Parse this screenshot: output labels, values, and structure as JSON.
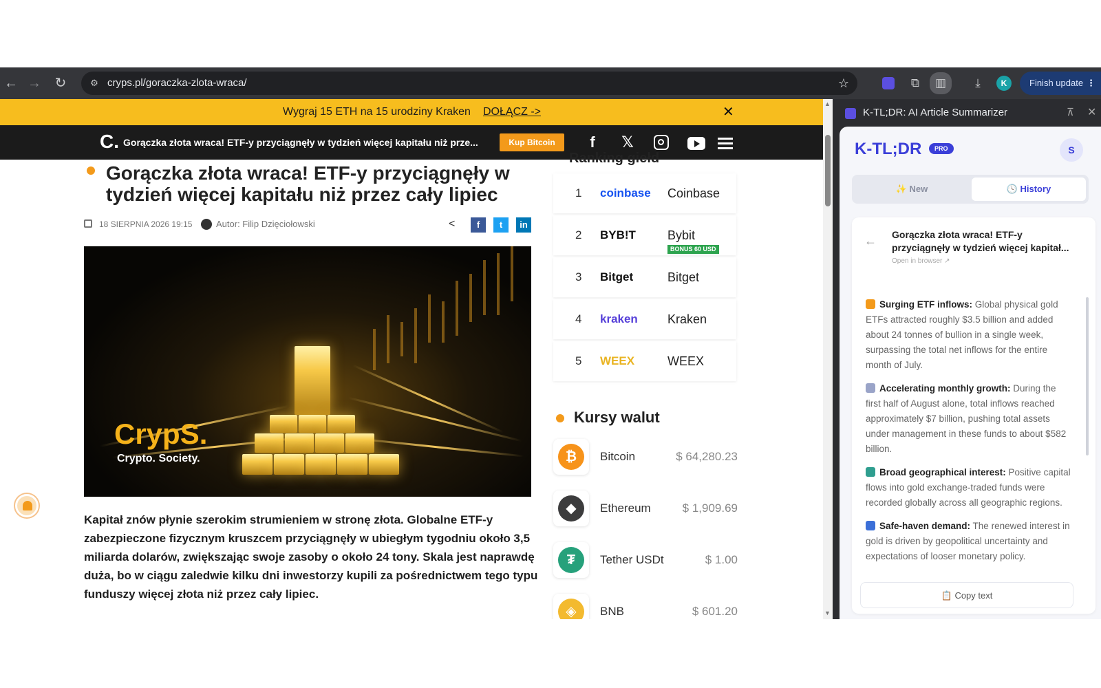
{
  "browser": {
    "url": "cryps.pl/goraczka-zlota-wraca/",
    "profile_initial": "K",
    "finish_update_label": "Finish update",
    "icons": [
      "back-icon",
      "forward-icon",
      "reload-icon",
      "site-info-icon",
      "star-icon",
      "ktldr-extension-icon",
      "extensions-puzzle-icon",
      "side-panel-icon",
      "download-icon",
      "more-vert-icon"
    ]
  },
  "site": {
    "promo": {
      "text": "Wygraj 15 ETH na 15 urodziny Kraken",
      "link": "DOŁĄCZ ->",
      "close": "✕"
    },
    "bar": {
      "logo": "C.",
      "title": "Gorączka złota wraca! ETF-y przyciągnęły w tydzień więcej kapitału niż prze...",
      "buy_label": "Kup Bitcoin"
    },
    "article": {
      "title": "Gorączka złota wraca! ETF-y przyciągnęły w tydzień więcej kapitału niż przez cały lipiec",
      "date": "18 SIERPNIA 2026 19:15",
      "author": "Autor: Filip Dzięciołowski",
      "hero_brand": "CrypS.",
      "hero_sub": "Crypto. Society.",
      "lead": "Kapitał znów płynie szerokim strumieniem w stronę złota. Globalne ETF-y zabezpieczone fizycznym kruszcem przyciągnęły w ubiegłym tygodniu około 3,5 miliarda dolarów, zwiększając swoje zasoby o około 24 tony. Skala jest naprawdę duża, bo w ciągu zaledwie kilku dni inwestorzy kupili za pośrednictwem tego typu funduszy więcej złota niż przez cały lipiec."
    },
    "ranking": {
      "heading": "Ranking giełd",
      "items": [
        {
          "num": "1",
          "logo": "coinbase",
          "name": "Coinbase",
          "color": "#1652f0"
        },
        {
          "num": "2",
          "logo": "BYB!T",
          "name": "Bybit",
          "color": "#111111",
          "bonus": "BONUS 60 USD"
        },
        {
          "num": "3",
          "logo": "Bitget",
          "name": "Bitget",
          "color": "#111111"
        },
        {
          "num": "4",
          "logo": "kraken",
          "name": "Kraken",
          "color": "#5741d9"
        },
        {
          "num": "5",
          "logo": "WEEX",
          "name": "WEEX",
          "color": "#e9b423"
        }
      ]
    },
    "rates": {
      "heading": "Kursy walut",
      "items": [
        {
          "name": "Bitcoin",
          "price": "$ 64,280.23",
          "symbol": "₿",
          "color": "#f7931a"
        },
        {
          "name": "Ethereum",
          "price": "$ 1,909.69",
          "symbol": "◆",
          "color": "#3c3c3d"
        },
        {
          "name": "Tether USDt",
          "price": "$ 1.00",
          "symbol": "₮",
          "color": "#26a17b"
        },
        {
          "name": "BNB",
          "price": "$ 601.20",
          "symbol": "◈",
          "color": "#f3ba2f"
        }
      ]
    }
  },
  "panel": {
    "title": "K-TL;DR: AI Article Summarizer",
    "brand": "K-TL;DR",
    "pro": "PRO",
    "user_initial": "S",
    "tabs": {
      "new": "✨ New",
      "history": "🕓 History"
    },
    "card": {
      "title": "Gorączka złota wraca! ETF-y przyciągnęły w tydzień więcej kapitał...",
      "open_link": "Open in browser ↗",
      "points": [
        {
          "icon_color": "#f39a1b",
          "heading": "Surging ETF inflows:",
          "text": " Global physical gold ETFs attracted roughly $3.5 billion and added about 24 tonnes of bullion in a single week, surpassing the total net inflows for the entire month of July."
        },
        {
          "icon_color": "#9aa4c8",
          "heading": "Accelerating monthly growth:",
          "text": " During the first half of August alone, total inflows reached approximately $7 billion, pushing total assets under management in these funds to about $582 billion."
        },
        {
          "icon_color": "#2f9e8f",
          "heading": "Broad geographical interest:",
          "text": " Positive capital flows into gold exchange-traded funds were recorded globally across all geographic regions."
        },
        {
          "icon_color": "#3b6fd8",
          "heading": "Safe-haven demand:",
          "text": " The renewed interest in gold is driven by geopolitical uncertainty and expectations of looser monetary policy."
        }
      ],
      "copy_label": "📋 Copy text"
    }
  }
}
